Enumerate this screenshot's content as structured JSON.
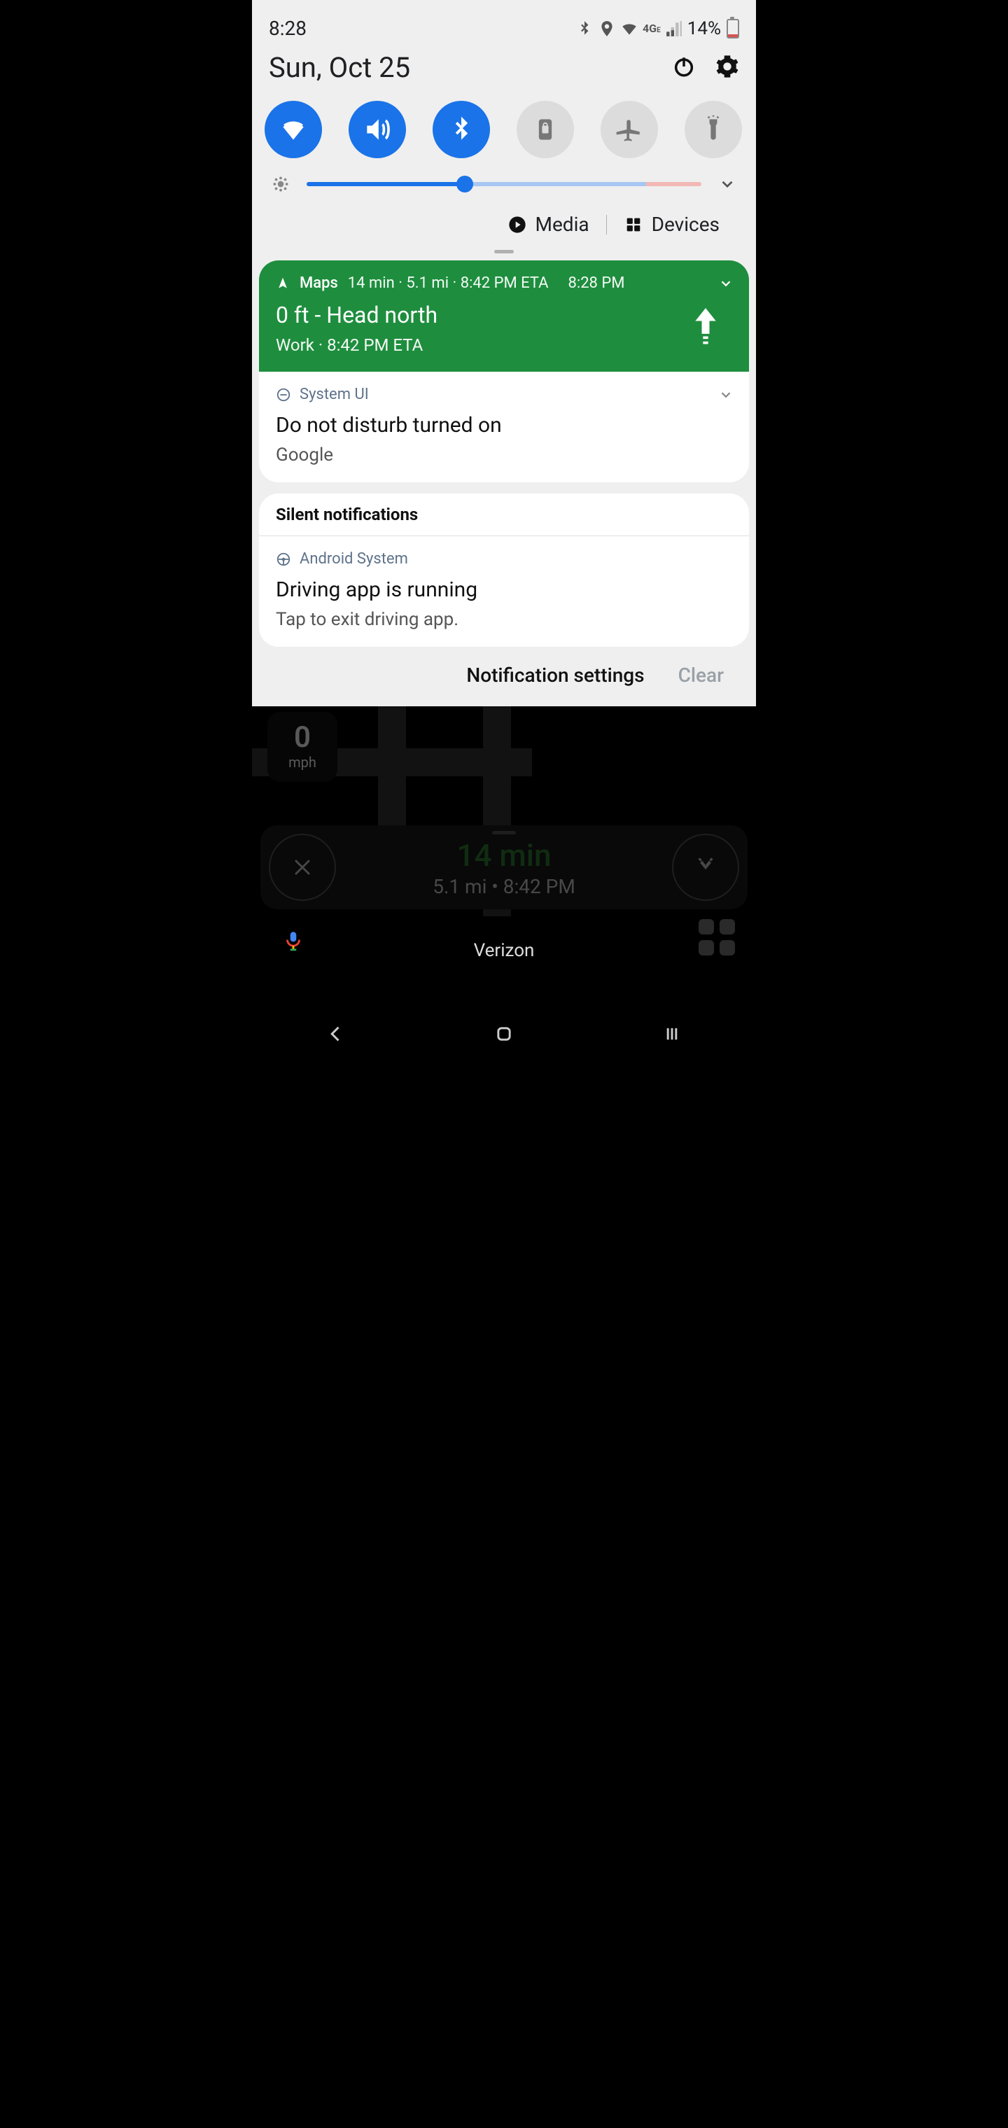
{
  "status": {
    "time": "8:28",
    "battery_pct": "14%"
  },
  "date": "Sun, Oct 25",
  "media_label": "Media",
  "devices_label": "Devices",
  "brightness_pct": 40,
  "notifications": {
    "maps": {
      "app": "Maps",
      "meta": "14 min · 5.1 mi · 8:42 PM ETA",
      "time": "8:28 PM",
      "title": "0 ft - Head north",
      "sub": "Work · 8:42 PM ETA"
    },
    "sysui": {
      "app": "System UI",
      "title": "Do not disturb turned on",
      "sub": "Google"
    },
    "silent_header": "Silent notifications",
    "android": {
      "app": "Android System",
      "title": "Driving app is running",
      "sub": "Tap to exit driving app."
    }
  },
  "actions": {
    "settings": "Notification settings",
    "clear": "Clear"
  },
  "bg": {
    "speed_value": "0",
    "speed_unit": "mph",
    "trip_time": "14 min",
    "trip_detail": "5.1 mi  •  8:42 PM",
    "carrier": "Verizon"
  }
}
